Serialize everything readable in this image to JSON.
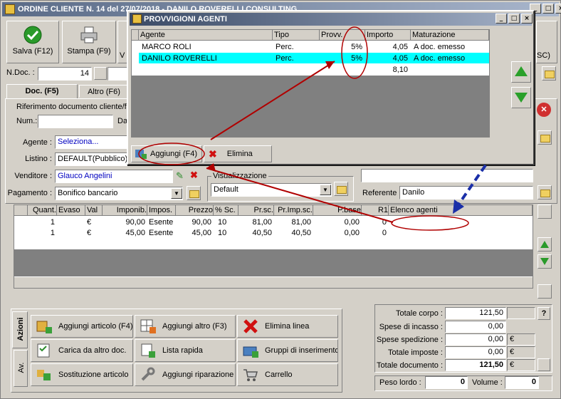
{
  "main_window": {
    "title": "ORDINE CLIENTE N. 14  del 27/07/2018 - DANILO ROVERELLI CONSULTING",
    "toolbar": {
      "save_label": "Salva (F12)",
      "print_label": "Stampa (F9)",
      "third_label": "V",
      "right_label": "SC)"
    },
    "ndoc_label": "N.Doc. :",
    "ndoc_value": "14",
    "tabs": [
      "Doc. (F5)",
      "Altro (F6)"
    ],
    "rif_title": "Riferimento documento cliente/f",
    "num_label": "Num.:",
    "da_label": "Da",
    "agente_label": "Agente :",
    "agente_value": "Seleziona...",
    "listino_label": "Listino :",
    "listino_value": "DEFAULT(Pubblico)",
    "venditore_label": "Venditore :",
    "venditore_value": "Glauco Angelini",
    "pagamento_label": "Pagamento :",
    "pagamento_value": "Bonifico bancario",
    "visualizzazione_label": "Visualizzazione",
    "visualizzazione_value": "Default",
    "referente_label": "Referente",
    "referente_value": "Danilo",
    "lines_table": {
      "headers": [
        "Quant.",
        "Evaso",
        "Val",
        "Imponib.",
        "Impos.",
        "Prezzo",
        "% Sc.",
        "Pr.sc.",
        "Pr.Imp.sc.",
        "P.base",
        "R1",
        "Elenco agenti"
      ],
      "rows": [
        [
          "1",
          "",
          "€",
          "90,00",
          "Esente",
          "90,00",
          "10",
          "81,00",
          "81,00",
          "0,00",
          "0",
          ""
        ],
        [
          "1",
          "",
          "€",
          "45,00",
          "Esente",
          "45,00",
          "10",
          "40,50",
          "40,50",
          "0,00",
          "0",
          ""
        ]
      ]
    },
    "side_tabs": [
      "Azioni",
      "Av."
    ],
    "actions": [
      "Aggiungi articolo (F4)",
      "Aggiungi altro (F3)",
      "Elimina linea",
      "Carica da altro doc.",
      "Lista rapida",
      "Gruppi di inserimento",
      "Sostituzione articolo",
      "Aggiungi riparazione",
      "Carrello"
    ],
    "totals": {
      "totale_corpo_label": "Totale corpo :",
      "totale_corpo": "121,50",
      "help_label": "?",
      "spese_incasso_label": "Spese di incasso :",
      "spese_incasso": "0,00",
      "spese_spedizione_label": "Spese spedizione :",
      "spese_spedizione": "0,00",
      "totale_imposte_label": "Totale imposte :",
      "totale_imposte": "0,00",
      "totale_documento_label": "Totale documento :",
      "totale_documento": "121,50",
      "currency": "€",
      "peso_lordo_label": "Peso lordo :",
      "peso_lordo": "0",
      "volume_label": "Volume :",
      "volume": "0"
    }
  },
  "dialog": {
    "title": "PROVVIGIONI AGENTI",
    "headers": [
      "Agente",
      "Tipo",
      "Provv.",
      "Importo",
      "Maturazione"
    ],
    "rows": [
      {
        "agente": "MARCO ROLI",
        "tipo": "Perc.",
        "provv": "5%",
        "importo": "4,05",
        "maturazione": "A doc. emesso"
      },
      {
        "agente": "DANILO ROVERELLI",
        "tipo": "Perc.",
        "provv": "5%",
        "importo": "4,05",
        "maturazione": "A doc. emesso"
      }
    ],
    "total_importo": "8,10",
    "add_label": "Aggiungi (F4)",
    "delete_label": "Elimina"
  },
  "colors": {
    "title_active": "#3a4a66",
    "selected_row": "#00ffff",
    "highlight_orange": "#ff9900",
    "annotation_red": "#b00000",
    "annotation_blue": "#1a2fa8"
  }
}
